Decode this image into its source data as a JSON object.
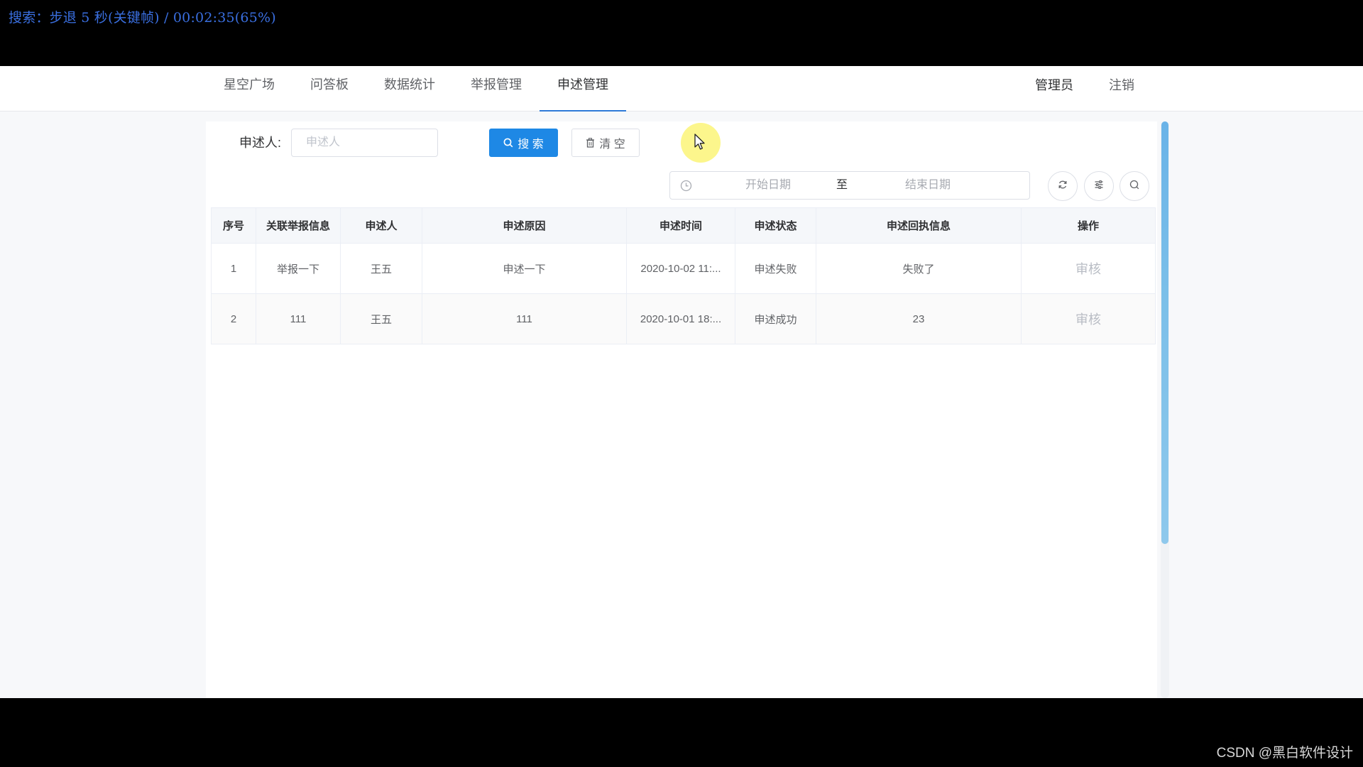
{
  "overlay": {
    "seek_text": "搜索：步退 5 秒(关键帧) / 00:02:35(65%)"
  },
  "nav": {
    "tabs": [
      {
        "label": "星空广场"
      },
      {
        "label": "问答板"
      },
      {
        "label": "数据统计"
      },
      {
        "label": "举报管理"
      },
      {
        "label": "申述管理",
        "active": true
      }
    ],
    "user": "管理员",
    "logout": "注销"
  },
  "search": {
    "label": "申述人:",
    "placeholder": "申述人",
    "value": "",
    "search_button": "搜 索",
    "clear_button": "清 空",
    "date_start_placeholder": "开始日期",
    "date_end_placeholder": "结束日期",
    "date_separator": "至"
  },
  "table": {
    "columns": [
      "序号",
      "关联举报信息",
      "申述人",
      "申述原因",
      "申述时间",
      "申述状态",
      "申述回执信息",
      "操作"
    ],
    "rows": [
      {
        "index": "1",
        "report": "举报一下",
        "person": "王五",
        "reason": "申述一下",
        "time": "2020-10-02 11:...",
        "status": "申述失败",
        "receipt": "失败了",
        "action": "审核"
      },
      {
        "index": "2",
        "report": "111",
        "person": "王五",
        "reason": "111",
        "time": "2020-10-01 18:...",
        "status": "申述成功",
        "receipt": "23",
        "action": "审核"
      }
    ]
  },
  "icons": {
    "search": "search-icon",
    "clear": "trash-icon",
    "date": "clock-icon",
    "refresh": "refresh-icon",
    "filter": "filter-icon",
    "search_toggle": "search-icon"
  },
  "colors": {
    "primary": "#1e88e5",
    "active_tab_underline": "#2f7ad8",
    "scrollbar": "#7bbfe9"
  },
  "watermark": "CSDN @黑白软件设计"
}
